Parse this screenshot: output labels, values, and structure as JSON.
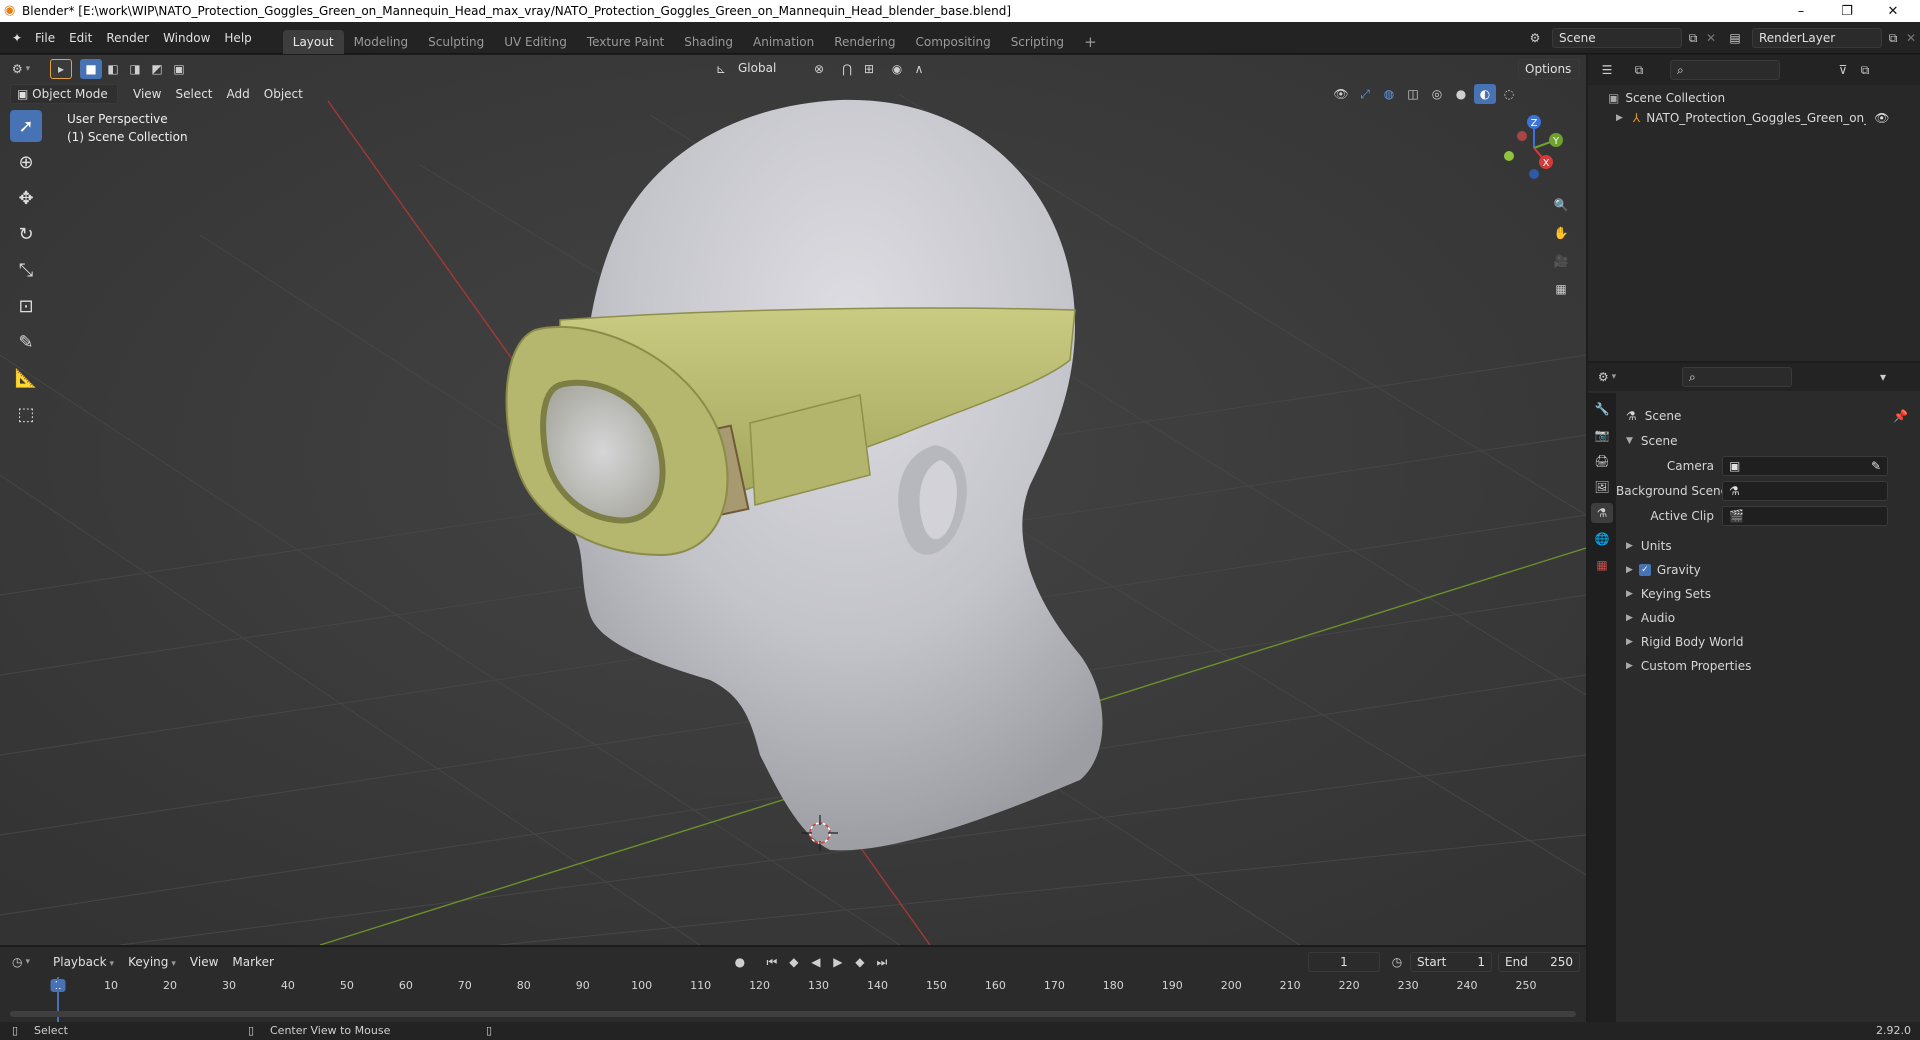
{
  "titlebar": {
    "title": "Blender* [E:\\work\\WIP\\NATO_Protection_Goggles_Green_on_Mannequin_Head_max_vray/NATO_Protection_Goggles_Green_on_Mannequin_Head_blender_base.blend]",
    "minimize": "–",
    "maximize": "❐",
    "close": "✕"
  },
  "menu": [
    "File",
    "Edit",
    "Render",
    "Window",
    "Help"
  ],
  "workspaces": [
    "Layout",
    "Modeling",
    "Sculpting",
    "UV Editing",
    "Texture Paint",
    "Shading",
    "Animation",
    "Rendering",
    "Compositing",
    "Scripting"
  ],
  "scene_field": "Scene",
  "renderlayer_field": "RenderLayer",
  "viewport": {
    "mode": "Object Mode",
    "menus": [
      "View",
      "Select",
      "Add",
      "Object"
    ],
    "orientation": "Global",
    "options": "Options",
    "overlay_line1": "User Perspective",
    "overlay_line2": "(1) Scene Collection",
    "gizmo": {
      "x": "X",
      "y": "Y",
      "z": "Z"
    }
  },
  "outliner": {
    "root": "Scene Collection",
    "item": "NATO_Protection_Goggles_Green_on_Manne"
  },
  "properties": {
    "header": "Scene",
    "panel": "Scene",
    "camera_label": "Camera",
    "bg_scene_label": "Background Scene",
    "active_clip_label": "Active Clip",
    "sections": [
      "Units",
      "Gravity",
      "Keying Sets",
      "Audio",
      "Rigid Body World",
      "Custom Properties"
    ]
  },
  "timeline": {
    "menus": [
      "Playback",
      "Keying",
      "View",
      "Marker"
    ],
    "current_frame": "1",
    "start_label": "Start",
    "start": "1",
    "end_label": "End",
    "end": "250",
    "ticks": [
      "1",
      "10",
      "20",
      "30",
      "40",
      "50",
      "60",
      "70",
      "80",
      "90",
      "100",
      "110",
      "120",
      "130",
      "140",
      "150",
      "160",
      "170",
      "180",
      "190",
      "200",
      "210",
      "220",
      "230",
      "240",
      "250"
    ]
  },
  "statusbar": {
    "select": "Select",
    "center_view": "Center View to Mouse",
    "version": "2.92.0"
  },
  "colors": {
    "accent": "#4772b3",
    "axis_x": "#c43b3b",
    "axis_y": "#6d9c2e",
    "head": "#c9c9cf",
    "goggles": "#b9bb6e"
  }
}
